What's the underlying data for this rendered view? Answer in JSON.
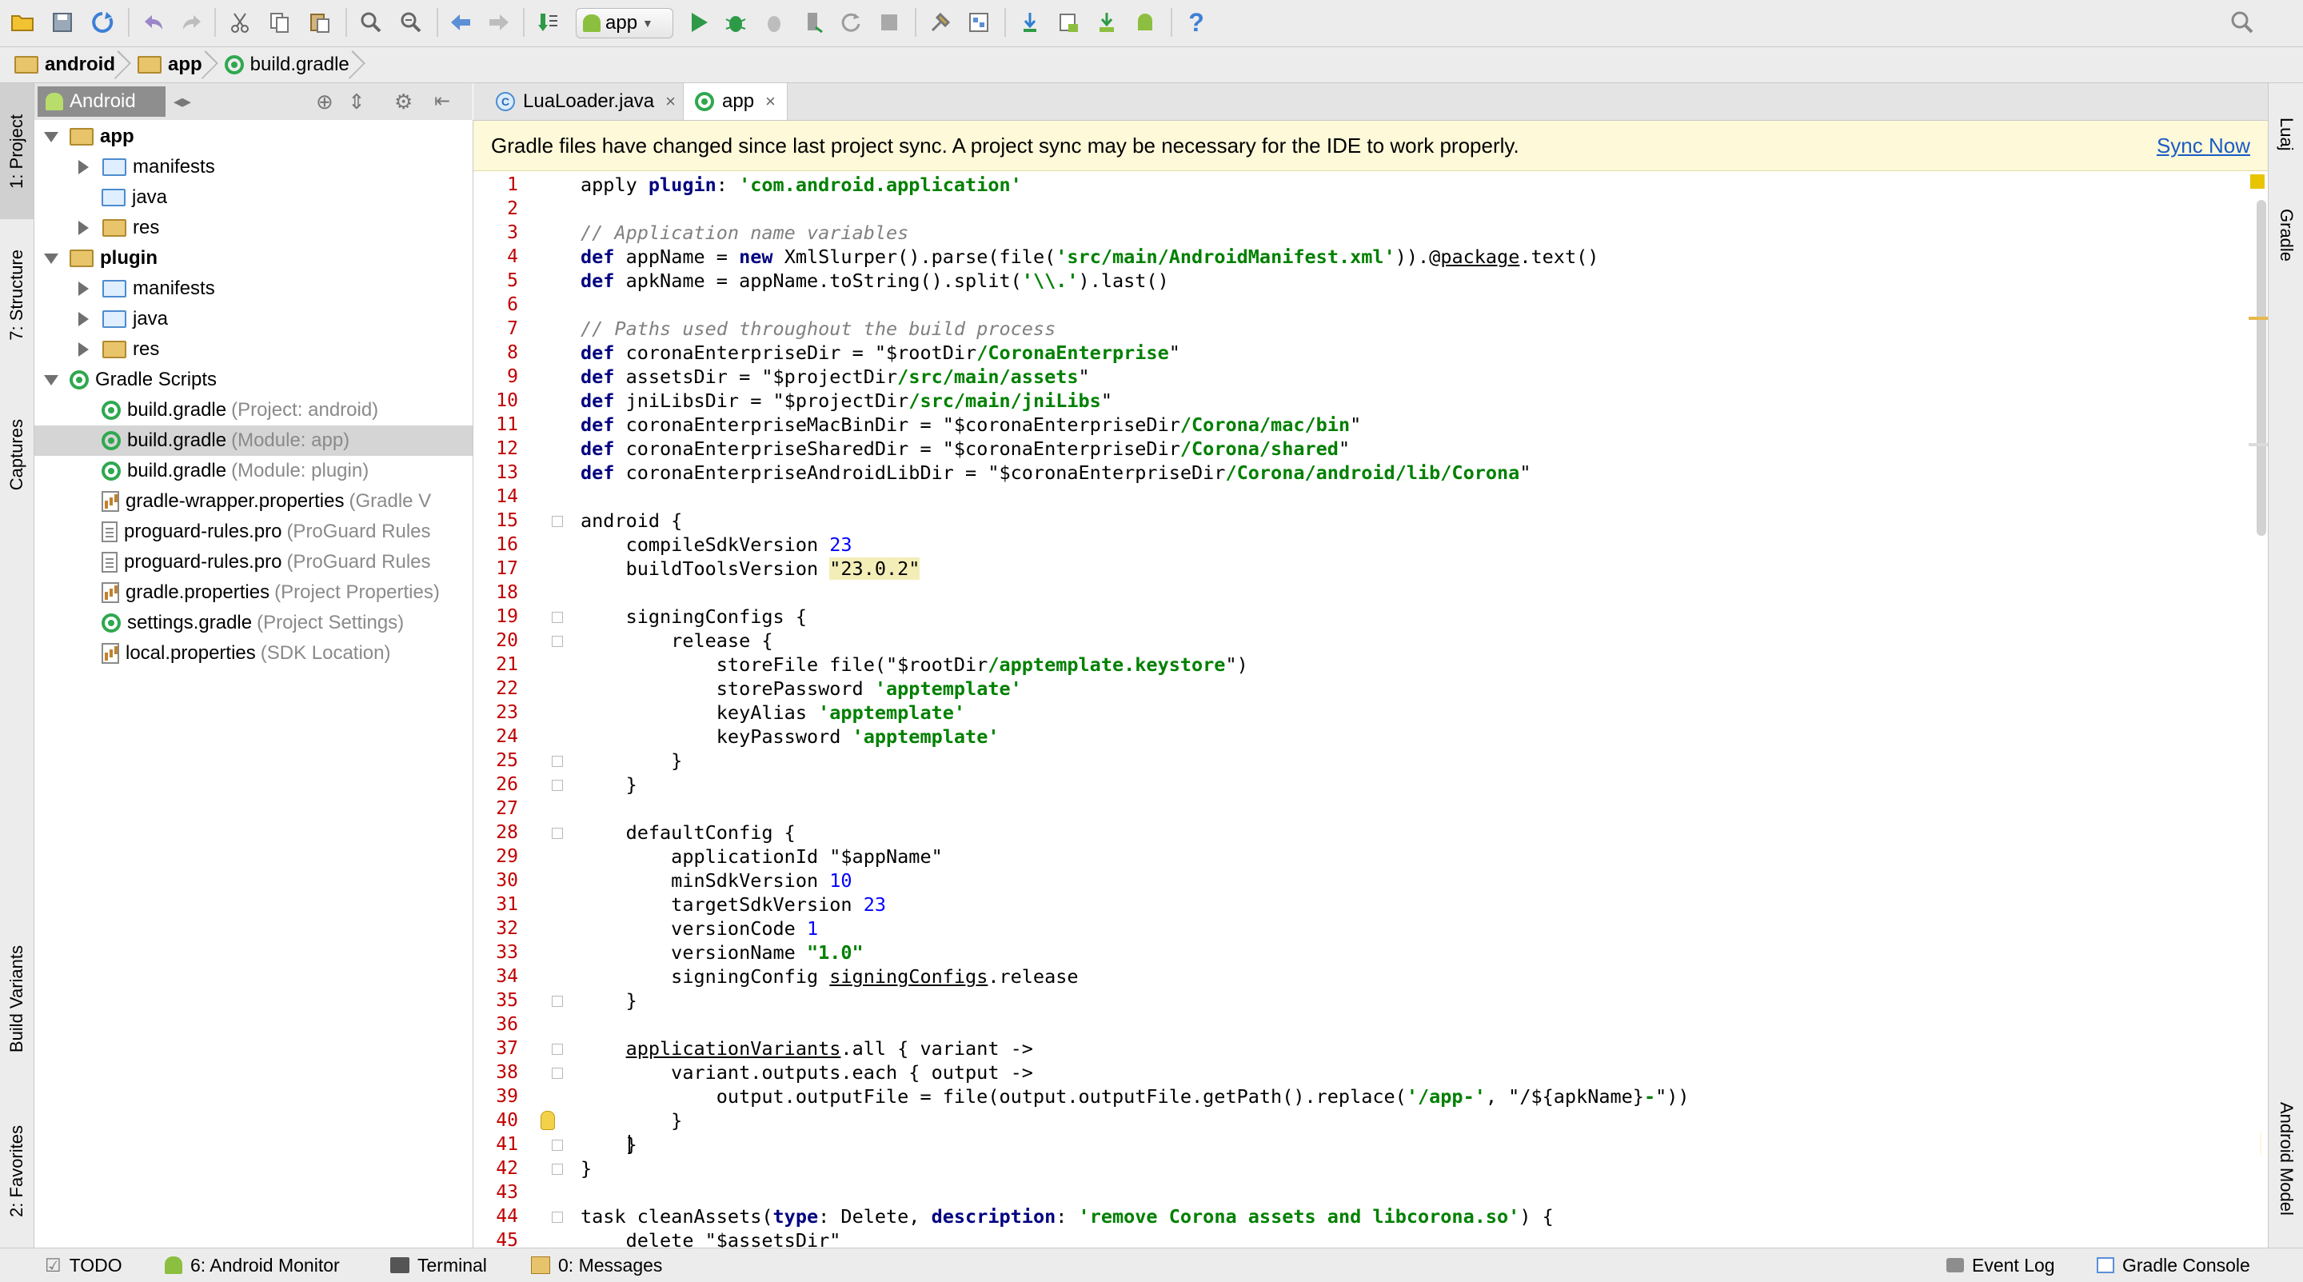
{
  "toolbar": {
    "run_config": "app",
    "icons": [
      "open-folder",
      "save",
      "sync",
      "undo",
      "redo",
      "cut",
      "copy",
      "paste",
      "find",
      "replace",
      "back",
      "forward",
      "make-project",
      "run-config",
      "run",
      "debug",
      "attach-debugger",
      "profile",
      "apply-changes",
      "stop",
      "sdk-manager",
      "project-structure",
      "gradle-sync",
      "avd-manager",
      "sdk-download",
      "android-device-monitor",
      "help",
      "search-everywhere"
    ]
  },
  "breadcrumb": [
    {
      "label": "android",
      "icon": "folder-icon"
    },
    {
      "label": "app",
      "icon": "folder-icon"
    },
    {
      "label": "build.gradle",
      "icon": "gradle-icon"
    }
  ],
  "left_tool_tabs": [
    {
      "label": "1: Project"
    },
    {
      "label": "7: Structure"
    },
    {
      "label": "Captures"
    },
    {
      "label": "Build Variants"
    },
    {
      "label": "2: Favorites"
    }
  ],
  "right_tool_tabs": [
    {
      "label": "Luaj"
    },
    {
      "label": "Gradle"
    },
    {
      "label": "Android Model"
    }
  ],
  "project_panel": {
    "view": "Android",
    "tree": [
      {
        "label": "app",
        "hint": "",
        "bold": true,
        "icon": "folder",
        "level": 0,
        "toggle": "open"
      },
      {
        "label": "manifests",
        "hint": "",
        "icon": "folder-blue",
        "level": 1,
        "toggle": "closed"
      },
      {
        "label": "java",
        "hint": "",
        "icon": "folder-blue",
        "level": 1,
        "toggle": "none"
      },
      {
        "label": "res",
        "hint": "",
        "icon": "folder",
        "level": 1,
        "toggle": "closed"
      },
      {
        "label": "plugin",
        "hint": "",
        "bold": true,
        "icon": "folder",
        "level": 0,
        "toggle": "open"
      },
      {
        "label": "manifests",
        "hint": "",
        "icon": "folder-blue",
        "level": 1,
        "toggle": "closed"
      },
      {
        "label": "java",
        "hint": "",
        "icon": "folder-blue",
        "level": 1,
        "toggle": "closed"
      },
      {
        "label": "res",
        "hint": "",
        "icon": "folder",
        "level": 1,
        "toggle": "closed"
      },
      {
        "label": "Gradle Scripts",
        "hint": "",
        "icon": "gradle",
        "level": 0,
        "toggle": "open"
      },
      {
        "label": "build.gradle",
        "hint": "(Project: android)",
        "icon": "gradle",
        "level": 1,
        "toggle": "none"
      },
      {
        "label": "build.gradle",
        "hint": "(Module: app)",
        "icon": "gradle",
        "level": 1,
        "toggle": "none",
        "selected": true
      },
      {
        "label": "build.gradle",
        "hint": "(Module: plugin)",
        "icon": "gradle",
        "level": 1,
        "toggle": "none"
      },
      {
        "label": "gradle-wrapper.properties",
        "hint": "(Gradle V",
        "icon": "props",
        "level": 1,
        "toggle": "none"
      },
      {
        "label": "proguard-rules.pro",
        "hint": "(ProGuard Rules",
        "icon": "file",
        "level": 1,
        "toggle": "none"
      },
      {
        "label": "proguard-rules.pro",
        "hint": "(ProGuard Rules",
        "icon": "file",
        "level": 1,
        "toggle": "none"
      },
      {
        "label": "gradle.properties",
        "hint": "(Project Properties)",
        "icon": "props",
        "level": 1,
        "toggle": "none"
      },
      {
        "label": "settings.gradle",
        "hint": "(Project Settings)",
        "icon": "gradle",
        "level": 1,
        "toggle": "none"
      },
      {
        "label": "local.properties",
        "hint": "(SDK Location)",
        "icon": "props",
        "level": 1,
        "toggle": "none"
      }
    ]
  },
  "editor": {
    "tabs": [
      {
        "label": "LuaLoader.java",
        "active": false,
        "icon": "class-icon"
      },
      {
        "label": "app",
        "active": true,
        "icon": "gradle-icon"
      }
    ],
    "banner": {
      "message": "Gradle files have changed since last project sync. A project sync may be necessary for the IDE to work properly.",
      "action": "Sync Now"
    },
    "line_numbers": [
      "1",
      "2",
      "3",
      "4",
      "5",
      "6",
      "7",
      "8",
      "9",
      "10",
      "11",
      "12",
      "13",
      "14",
      "15",
      "16",
      "17",
      "18",
      "19",
      "20",
      "21",
      "22",
      "23",
      "24",
      "25",
      "26",
      "27",
      "28",
      "29",
      "30",
      "31",
      "32",
      "33",
      "34",
      "35",
      "36",
      "37",
      "38",
      "39",
      "40",
      "41",
      "42",
      "43",
      "44",
      "45"
    ],
    "lines": [
      [
        [
          "t",
          "apply "
        ],
        [
          "kw",
          "plugin"
        ],
        [
          "t",
          ": "
        ],
        [
          "str",
          "'com.android.application'"
        ]
      ],
      [],
      [
        [
          "cmt",
          "// Application name variables"
        ]
      ],
      [
        [
          "kw",
          "def"
        ],
        [
          "t",
          " appName = "
        ],
        [
          "kw",
          "new"
        ],
        [
          "t",
          " XmlSlurper().parse(file("
        ],
        [
          "str",
          "'src/main/AndroidManifest.xml'"
        ],
        [
          "t",
          ")).@"
        ],
        [
          "und",
          "package"
        ],
        [
          "t",
          ".text()"
        ]
      ],
      [
        [
          "kw",
          "def"
        ],
        [
          "t",
          " apkName = appName.toString().split("
        ],
        [
          "str",
          "'\\\\.'"
        ],
        [
          "t",
          ").last()"
        ]
      ],
      [],
      [
        [
          "cmt",
          "// Paths used throughout the build process"
        ]
      ],
      [
        [
          "kw",
          "def"
        ],
        [
          "t",
          " coronaEnterpriseDir = \"$rootDir"
        ],
        [
          "str",
          "/CoronaEnterprise"
        ],
        [
          "t",
          "\""
        ]
      ],
      [
        [
          "kw",
          "def"
        ],
        [
          "t",
          " assetsDir = \"$projectDir"
        ],
        [
          "str",
          "/src/main/assets"
        ],
        [
          "t",
          "\""
        ]
      ],
      [
        [
          "kw",
          "def"
        ],
        [
          "t",
          " jniLibsDir = \"$projectDir"
        ],
        [
          "str",
          "/src/main/jniLibs"
        ],
        [
          "t",
          "\""
        ]
      ],
      [
        [
          "kw",
          "def"
        ],
        [
          "t",
          " coronaEnterpriseMacBinDir = \"$coronaEnterpriseDir"
        ],
        [
          "str",
          "/Corona/mac/bin"
        ],
        [
          "t",
          "\""
        ]
      ],
      [
        [
          "kw",
          "def"
        ],
        [
          "t",
          " coronaEnterpriseSharedDir = \"$coronaEnterpriseDir"
        ],
        [
          "str",
          "/Corona/shared"
        ],
        [
          "t",
          "\""
        ]
      ],
      [
        [
          "kw",
          "def"
        ],
        [
          "t",
          " coronaEnterpriseAndroidLibDir = \"$coronaEnterpriseDir"
        ],
        [
          "str",
          "/Corona/android/lib/Corona"
        ],
        [
          "t",
          "\""
        ]
      ],
      [],
      [
        [
          "t",
          "android {"
        ]
      ],
      [
        [
          "t",
          "    compileSdkVersion "
        ],
        [
          "num",
          "23"
        ]
      ],
      [
        [
          "t",
          "    buildToolsVersion "
        ],
        [
          "hl",
          "\"23.0.2\""
        ]
      ],
      [],
      [
        [
          "t",
          "    signingConfigs {"
        ]
      ],
      [
        [
          "t",
          "        release {"
        ]
      ],
      [
        [
          "t",
          "            storeFile file(\"$rootDir"
        ],
        [
          "str",
          "/apptemplate.keystore"
        ],
        [
          "t",
          "\")"
        ]
      ],
      [
        [
          "t",
          "            storePassword "
        ],
        [
          "str",
          "'apptemplate'"
        ]
      ],
      [
        [
          "t",
          "            keyAlias "
        ],
        [
          "str",
          "'apptemplate'"
        ]
      ],
      [
        [
          "t",
          "            keyPassword "
        ],
        [
          "str",
          "'apptemplate'"
        ]
      ],
      [
        [
          "t",
          "        }"
        ]
      ],
      [
        [
          "t",
          "    }"
        ]
      ],
      [],
      [
        [
          "t",
          "    defaultConfig {"
        ]
      ],
      [
        [
          "t",
          "        applicationId \"$appName\""
        ]
      ],
      [
        [
          "t",
          "        minSdkVersion "
        ],
        [
          "num",
          "10"
        ]
      ],
      [
        [
          "t",
          "        targetSdkVersion "
        ],
        [
          "num",
          "23"
        ]
      ],
      [
        [
          "t",
          "        versionCode "
        ],
        [
          "num",
          "1"
        ]
      ],
      [
        [
          "t",
          "        versionName "
        ],
        [
          "str",
          "\"1.0\""
        ]
      ],
      [
        [
          "t",
          "        signingConfig "
        ],
        [
          "und",
          "signingConfigs"
        ],
        [
          "t",
          ".release"
        ]
      ],
      [
        [
          "t",
          "    }"
        ]
      ],
      [],
      [
        [
          "t",
          "    "
        ],
        [
          "und",
          "applicationVariants"
        ],
        [
          "t",
          ".all { variant ->"
        ]
      ],
      [
        [
          "t",
          "        variant.outputs.each { output ->"
        ]
      ],
      [
        [
          "t",
          "            output.outputFile = file(output.outputFile.getPath().replace("
        ],
        [
          "str",
          "'/app-'"
        ],
        [
          "t",
          ", \"/${apkName}"
        ],
        [
          "str",
          "-"
        ],
        [
          "t",
          "\"))"
        ]
      ],
      [
        [
          "t",
          "        }"
        ]
      ],
      [
        [
          "t",
          "    }"
        ]
      ],
      [
        [
          "t",
          "}"
        ]
      ],
      [],
      [
        [
          "t",
          "task cleanAssets("
        ],
        [
          "kw",
          "type"
        ],
        [
          "t",
          ": Delete, "
        ],
        [
          "kw",
          "description"
        ],
        [
          "t",
          ": "
        ],
        [
          "str",
          "'remove Corona assets and libcorona.so'"
        ],
        [
          "t",
          ") {"
        ]
      ],
      [
        [
          "t",
          "    delete \"$assetsDir\""
        ]
      ]
    ]
  },
  "status_bar": {
    "left": [
      {
        "label": "TODO",
        "icon": "todo-icon"
      },
      {
        "label": "6: Android Monitor",
        "icon": "android-icon"
      },
      {
        "label": "Terminal",
        "icon": "terminal-icon"
      },
      {
        "label": "0: Messages",
        "icon": "messages-icon"
      }
    ],
    "right": [
      {
        "label": "Event Log",
        "icon": "event-log-icon"
      },
      {
        "label": "Gradle Console",
        "icon": "gradle-console-icon"
      }
    ]
  }
}
